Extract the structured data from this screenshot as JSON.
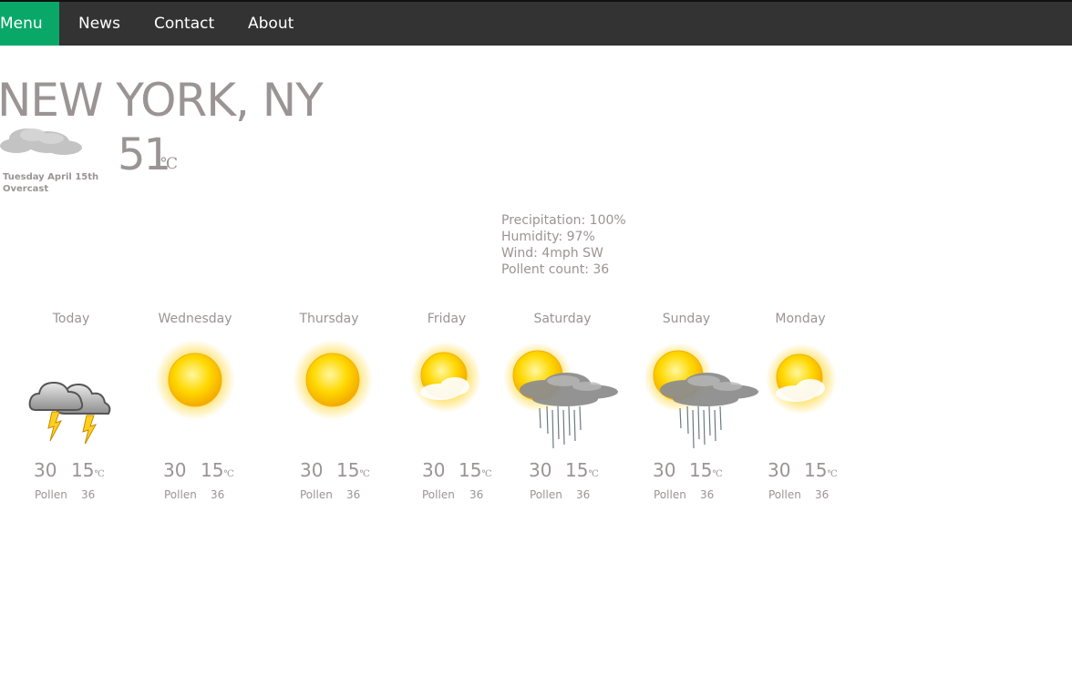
{
  "nav": {
    "menu": "Menu",
    "items": [
      "News",
      "Contact",
      "About"
    ],
    "bg": "#333333",
    "accent": "#0aa868"
  },
  "current": {
    "city": "NEW YORK, NY",
    "temp": "51",
    "unit": "℃",
    "date": "Tuesday April 15th",
    "condition": "Overcast",
    "icon": "overcast-cloud-icon"
  },
  "details": {
    "precipitation": "Precipitation: 100%",
    "humidity": "Humidity: 97%",
    "wind": "Wind: 4mph SW",
    "pollen": "Pollent count: 36"
  },
  "forecast": [
    {
      "day": "Today",
      "hi": "30",
      "lo": "15",
      "unit": "℃",
      "pollen_label": "Pollen",
      "pollen": "36",
      "icon": "thunderstorm-icon"
    },
    {
      "day": "Wednesday",
      "hi": "30",
      "lo": "15",
      "unit": "℃",
      "pollen_label": "Pollen",
      "pollen": "36",
      "icon": "sun-icon"
    },
    {
      "day": "Thursday",
      "hi": "30",
      "lo": "15",
      "unit": "℃",
      "pollen_label": "Pollen",
      "pollen": "36",
      "icon": "sun-icon"
    },
    {
      "day": "Friday",
      "hi": "30",
      "lo": "15",
      "unit": "℃",
      "pollen_label": "Pollen",
      "pollen": "36",
      "icon": "partly-sunny-icon"
    },
    {
      "day": "Saturday",
      "hi": "30",
      "lo": "15",
      "unit": "℃",
      "pollen_label": "Pollen",
      "pollen": "36",
      "icon": "sun-rain-icon"
    },
    {
      "day": "Sunday",
      "hi": "30",
      "lo": "15",
      "unit": "℃",
      "pollen_label": "Pollen",
      "pollen": "36",
      "icon": "sun-rain-icon"
    },
    {
      "day": "Monday",
      "hi": "30",
      "lo": "15",
      "unit": "℃",
      "pollen_label": "Pollen",
      "pollen": "36",
      "icon": "partly-sunny-icon"
    }
  ]
}
